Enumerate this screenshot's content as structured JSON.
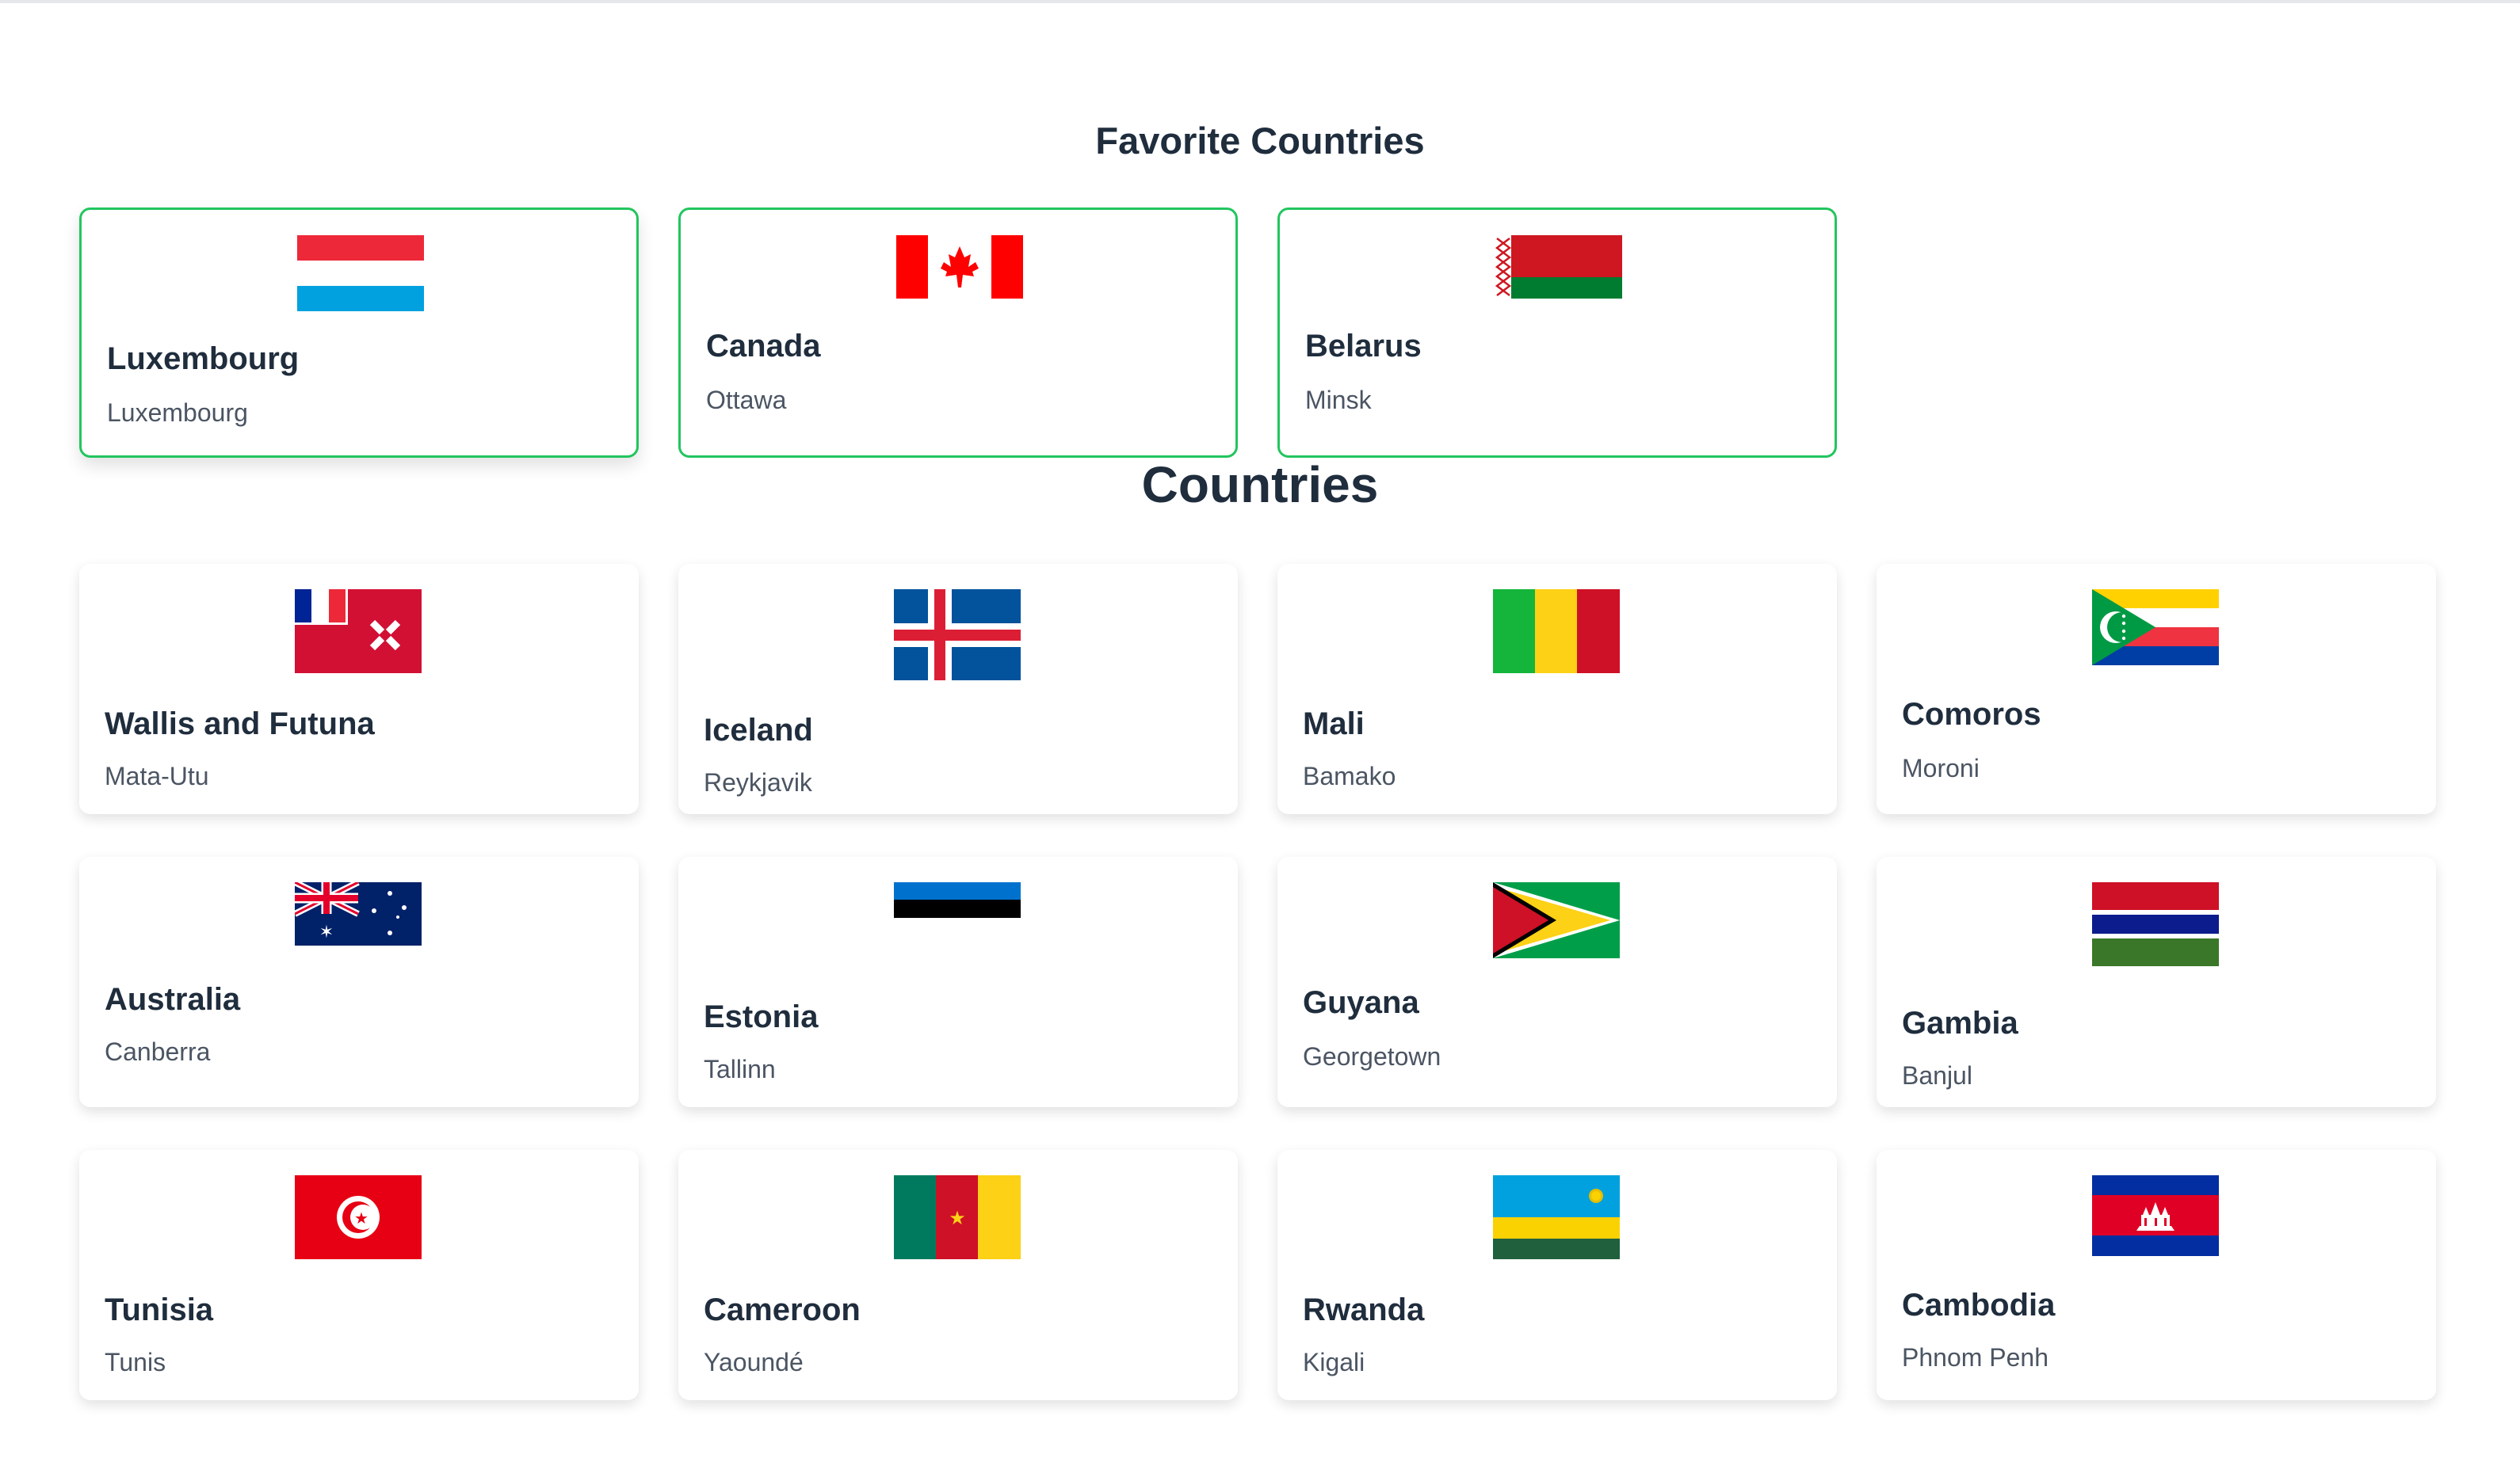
{
  "favorites": {
    "title": "Favorite Countries",
    "items": [
      {
        "name": "Luxembourg",
        "capital": "Luxembourg",
        "flag": "luxembourg-flag-icon"
      },
      {
        "name": "Canada",
        "capital": "Ottawa",
        "flag": "canada-flag-icon"
      },
      {
        "name": "Belarus",
        "capital": "Minsk",
        "flag": "belarus-flag-icon"
      }
    ]
  },
  "countries": {
    "title": "Countries",
    "items": [
      {
        "name": "Wallis and Futuna",
        "capital": "Mata-Utu",
        "flag": "wallis-and-futuna-flag-icon"
      },
      {
        "name": "Iceland",
        "capital": "Reykjavik",
        "flag": "iceland-flag-icon"
      },
      {
        "name": "Mali",
        "capital": "Bamako",
        "flag": "mali-flag-icon"
      },
      {
        "name": "Comoros",
        "capital": "Moroni",
        "flag": "comoros-flag-icon"
      },
      {
        "name": "Australia",
        "capital": "Canberra",
        "flag": "australia-flag-icon"
      },
      {
        "name": "Estonia",
        "capital": "Tallinn",
        "flag": "estonia-flag-icon"
      },
      {
        "name": "Guyana",
        "capital": "Georgetown",
        "flag": "guyana-flag-icon"
      },
      {
        "name": "Gambia",
        "capital": "Banjul",
        "flag": "gambia-flag-icon"
      },
      {
        "name": "Tunisia",
        "capital": "Tunis",
        "flag": "tunisia-flag-icon"
      },
      {
        "name": "Cameroon",
        "capital": "Yaoundé",
        "flag": "cameroon-flag-icon"
      },
      {
        "name": "Rwanda",
        "capital": "Kigali",
        "flag": "rwanda-flag-icon"
      },
      {
        "name": "Cambodia",
        "capital": "Phnom Penh",
        "flag": "cambodia-flag-icon"
      }
    ]
  },
  "colors": {
    "favorite_border": "#22c55e",
    "heading": "#1f2d3d",
    "capital_text": "#4b5563"
  }
}
